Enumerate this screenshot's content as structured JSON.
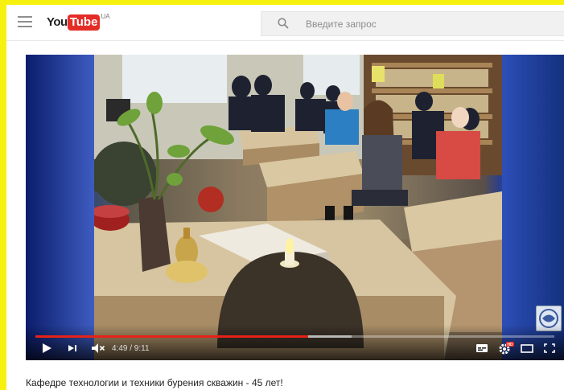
{
  "header": {
    "logo_text_you": "You",
    "logo_text_tube": "Tube",
    "logo_country": "UA",
    "search_placeholder": "Введите запрос"
  },
  "player": {
    "current_time": "4:49",
    "duration": "9:11",
    "time_display": "4:49 / 9:11",
    "progress": 0.525,
    "buffered": 0.61,
    "hd_badge": "HD"
  },
  "video": {
    "title": "Кафедре технологии и техники бурения скважин - 45 лет!"
  },
  "colors": {
    "page_border": "#f7f10f",
    "progress_red": "#e62117",
    "youtube_red": "#e52d27"
  }
}
